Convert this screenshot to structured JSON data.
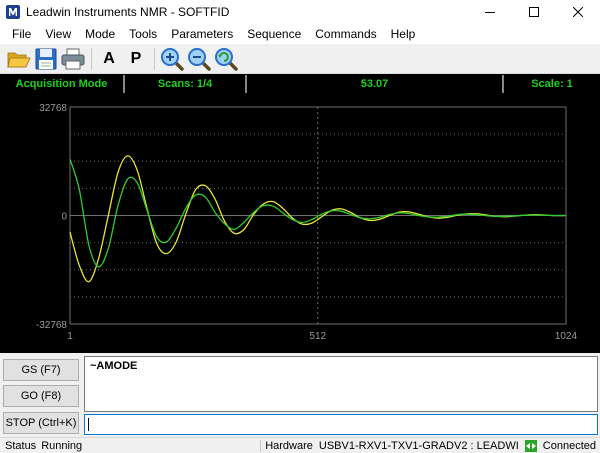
{
  "window": {
    "title": "Leadwin Instruments NMR - SOFTFID"
  },
  "menu": [
    "File",
    "View",
    "Mode",
    "Tools",
    "Parameters",
    "Sequence",
    "Commands",
    "Help"
  ],
  "toolbar": {
    "letter_a": "A",
    "letter_p": "P"
  },
  "status_row": {
    "mode": "Acquisition Mode",
    "scans": "Scans: 1/4",
    "value": "53.07",
    "scale": "Scale: 1"
  },
  "colors": {
    "real": "#e6e632",
    "imag": "#2ecc2e",
    "status_text": "#1fd11f",
    "grid": "#6e6e6e"
  },
  "chart_data": {
    "type": "line",
    "x_ticks": [
      "1",
      "512",
      "1024"
    ],
    "y_ticks": [
      "32768",
      "0",
      "-32768"
    ],
    "xlim": [
      1,
      1024
    ],
    "ylim": [
      -32768,
      32768
    ],
    "grid": true,
    "series": [
      {
        "color": "#e6e632",
        "x": [
          1,
          20,
          40,
          60,
          80,
          100,
          120,
          140,
          160,
          180,
          200,
          220,
          240,
          260,
          280,
          300,
          320,
          340,
          360,
          380,
          400,
          420,
          440,
          460,
          480,
          500,
          520,
          540,
          560,
          580,
          600,
          620,
          640,
          660,
          680,
          700,
          720,
          740,
          760,
          780,
          800,
          820,
          840,
          860,
          880,
          900,
          920,
          940,
          960,
          980,
          1000,
          1024
        ],
        "y": [
          -5000,
          -15000,
          -20000,
          -13000,
          0,
          13000,
          18000,
          13500,
          2000,
          -8500,
          -11500,
          -8000,
          500,
          7800,
          9000,
          5000,
          -1800,
          -5400,
          -4200,
          400,
          3500,
          4200,
          2200,
          -800,
          -2600,
          -2300,
          -400,
          1500,
          2000,
          900,
          -700,
          -1500,
          -1100,
          0,
          1000,
          1100,
          400,
          -400,
          -800,
          -500,
          100,
          500,
          500,
          150,
          -250,
          -350,
          -150,
          120,
          250,
          150,
          -30,
          0
        ]
      },
      {
        "color": "#2ecc2e",
        "x": [
          1,
          20,
          40,
          60,
          80,
          100,
          120,
          140,
          160,
          180,
          200,
          220,
          240,
          260,
          280,
          300,
          320,
          340,
          360,
          380,
          400,
          420,
          440,
          460,
          480,
          500,
          520,
          540,
          560,
          580,
          600,
          620,
          640,
          660,
          680,
          700,
          720,
          740,
          760,
          780,
          800,
          820,
          840,
          860,
          880,
          900,
          920,
          940,
          960,
          980,
          1000,
          1024
        ],
        "y": [
          17000,
          8000,
          -9000,
          -15500,
          -10000,
          3000,
          11000,
          9800,
          1500,
          -6500,
          -8000,
          -3800,
          2200,
          6200,
          5600,
          1000,
          -2500,
          -4200,
          -2000,
          1000,
          3000,
          2800,
          800,
          -1200,
          -2100,
          -1200,
          400,
          1400,
          1300,
          300,
          -700,
          -1000,
          -500,
          300,
          800,
          600,
          0,
          -400,
          -500,
          -200,
          250,
          400,
          250,
          -50,
          -250,
          -200,
          -50,
          100,
          150,
          80,
          0,
          0
        ]
      }
    ]
  },
  "buttons": {
    "gs": "GS (F7)",
    "go": "GO (F8)",
    "stop": "STOP (Ctrl+K)"
  },
  "console": {
    "text": "~AMODE",
    "input_value": ""
  },
  "statusbar": {
    "status_label": "Status",
    "status_value": "Running",
    "hardware_label": "Hardware",
    "hardware_value": "USBV1-RXV1-TXV1-GRADV2 : LEADWI",
    "connection": "Connected"
  }
}
